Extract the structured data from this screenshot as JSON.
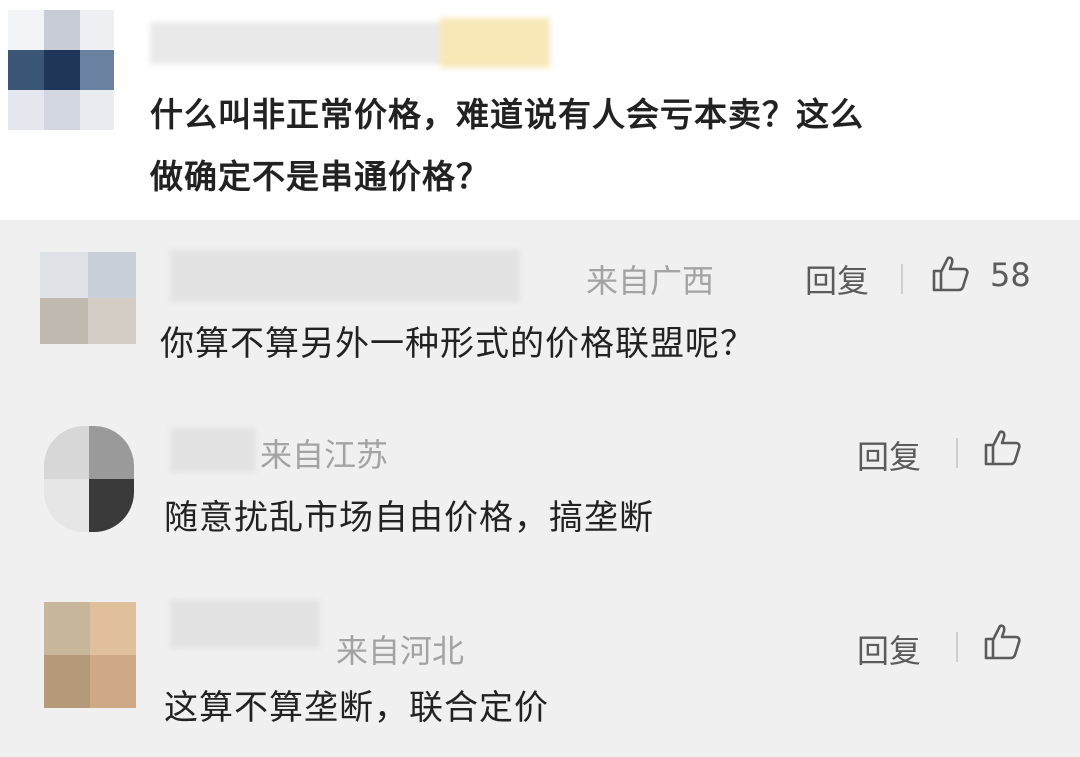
{
  "top_comment": {
    "text_line1": "什么叫非正常价格，难道说有人会亏本卖？这么",
    "text_line2": "做确定不是串通价格？"
  },
  "replies": [
    {
      "location": "来自广西",
      "reply_label": "回复",
      "like_count": "58",
      "text": "你算不算另外一种形式的价格联盟呢？"
    },
    {
      "location": "来自江苏",
      "reply_label": "回复",
      "text": "随意扰乱市场自由价格，搞垄断"
    },
    {
      "location": "来自河北",
      "reply_label": "回复",
      "text": "这算不算垄断，联合定价"
    }
  ],
  "icons": {
    "like": "thumbs-up-icon"
  },
  "colors": {
    "text": "#222222",
    "meta_gray": "#a3a3a3",
    "reply_bg": "#f0f0f0"
  }
}
